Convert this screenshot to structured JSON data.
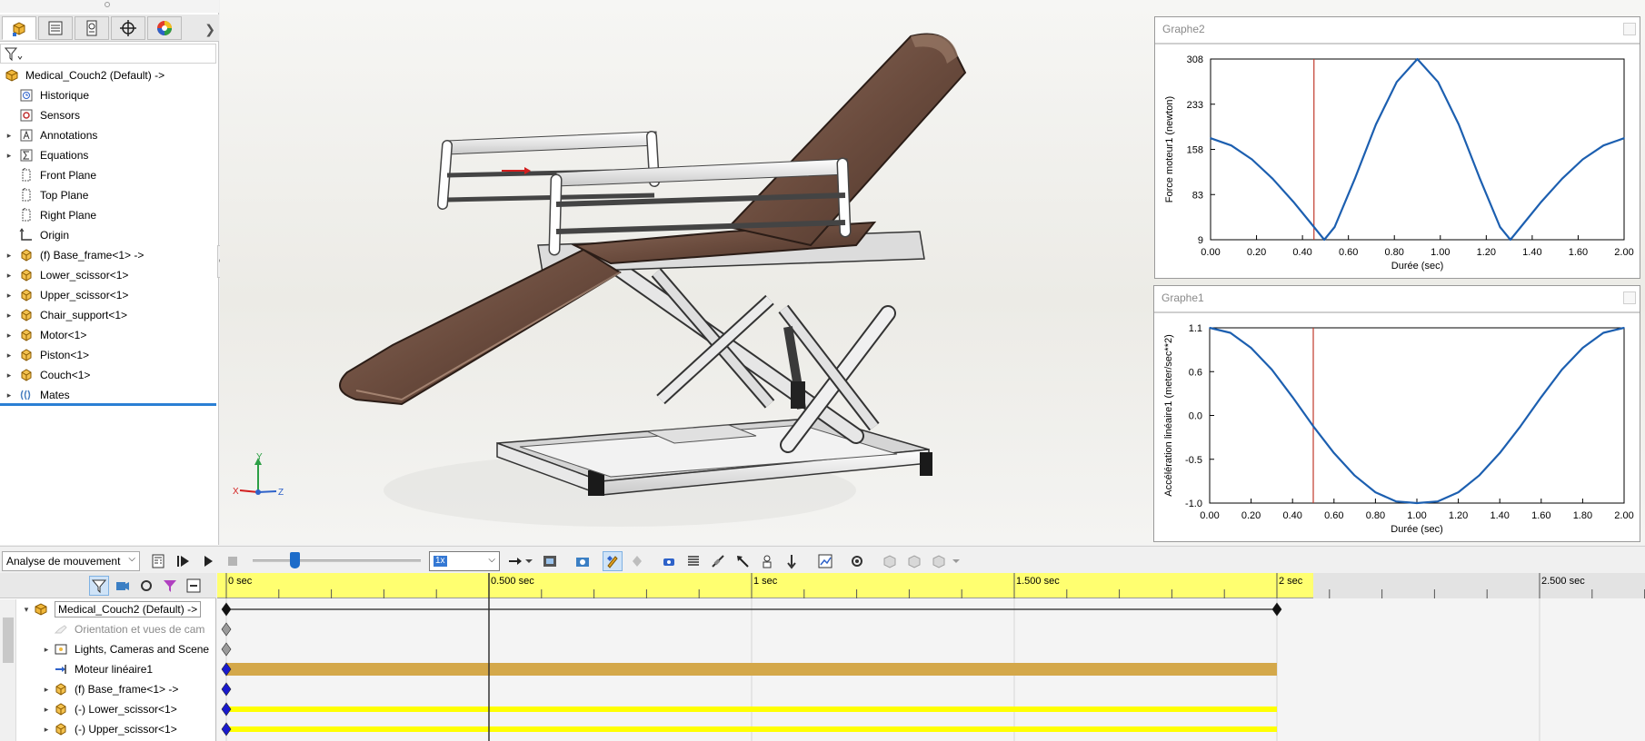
{
  "feature_manager": {
    "tabs": [
      "featuremanager-tab",
      "propertymanager-tab",
      "configuration-tab",
      "dimxpert-tab",
      "appearance-tab"
    ],
    "tree": [
      {
        "label": "Medical_Couch2  (Default) ->",
        "icon": "assembly-icon",
        "expandable": false
      },
      {
        "label": "Historique",
        "icon": "history-icon",
        "expandable": false
      },
      {
        "label": "Sensors",
        "icon": "sensor-icon",
        "expandable": false
      },
      {
        "label": "Annotations",
        "icon": "annotation-icon",
        "expandable": true
      },
      {
        "label": "Equations",
        "icon": "equation-icon",
        "expandable": true
      },
      {
        "label": "Front Plane",
        "icon": "plane-icon",
        "expandable": false
      },
      {
        "label": "Top Plane",
        "icon": "plane-icon",
        "expandable": false
      },
      {
        "label": "Right Plane",
        "icon": "plane-icon",
        "expandable": false
      },
      {
        "label": "Origin",
        "icon": "origin-icon",
        "expandable": false
      },
      {
        "label": "(f) Base_frame<1> ->",
        "icon": "part-icon",
        "expandable": true
      },
      {
        "label": "Lower_scissor<1>",
        "icon": "part-icon",
        "expandable": true
      },
      {
        "label": "Upper_scissor<1>",
        "icon": "part-icon",
        "expandable": true
      },
      {
        "label": "Chair_support<1>",
        "icon": "part-icon",
        "expandable": true
      },
      {
        "label": "Motor<1>",
        "icon": "part-icon",
        "expandable": true
      },
      {
        "label": "Piston<1>",
        "icon": "part-icon",
        "expandable": true
      },
      {
        "label": "Couch<1>",
        "icon": "part-icon",
        "expandable": true
      },
      {
        "label": "Mates",
        "icon": "mates-icon",
        "expandable": true
      }
    ]
  },
  "graphs": [
    {
      "title": "Graphe2",
      "ylabel": "Force moteur1 (newton)",
      "xlabel": "Durée (sec)",
      "yticks": [
        "308",
        "233",
        "158",
        "83",
        "9"
      ],
      "xticks": [
        "0.00",
        "0.20",
        "0.40",
        "0.60",
        "0.80",
        "1.00",
        "1.20",
        "1.40",
        "1.60",
        "2.00"
      ]
    },
    {
      "title": "Graphe1",
      "ylabel": "Accélération linéaire1 (meter/sec**2)",
      "xlabel": "Durée (sec)",
      "yticks": [
        "1.1",
        "0.6",
        "0.0",
        "-0.5",
        "-1.0"
      ],
      "xticks": [
        "0.00",
        "0.20",
        "0.40",
        "0.60",
        "0.80",
        "1.00",
        "1.20",
        "1.40",
        "1.60",
        "1.80",
        "2.00"
      ]
    }
  ],
  "chart_data": [
    {
      "type": "line",
      "title": "Graphe2",
      "xlabel": "Durée (sec)",
      "ylabel": "Force moteur1 (newton)",
      "xlim": [
        0,
        2
      ],
      "ylim": [
        9,
        308
      ],
      "x": [
        0,
        0.1,
        0.2,
        0.3,
        0.4,
        0.5,
        0.55,
        0.6,
        0.7,
        0.8,
        0.9,
        1.0,
        1.1,
        1.2,
        1.3,
        1.4,
        1.45,
        1.5,
        1.6,
        1.7,
        1.8,
        1.9,
        2.0
      ],
      "series": [
        {
          "values": [
            177,
            165,
            142,
            110,
            72,
            30,
            9,
            30,
            112,
            200,
            270,
            308,
            270,
            200,
            112,
            30,
            9,
            30,
            72,
            110,
            142,
            165,
            177
          ]
        }
      ],
      "cursor_x": 0.5
    },
    {
      "type": "line",
      "title": "Graphe1",
      "xlabel": "Durée (sec)",
      "ylabel": "Accélération linéaire1 (meter/sec**2)",
      "xlim": [
        0,
        2
      ],
      "ylim": [
        -1.0,
        1.1
      ],
      "x": [
        0,
        0.1,
        0.2,
        0.3,
        0.4,
        0.5,
        0.6,
        0.7,
        0.8,
        0.9,
        1.0,
        1.1,
        1.2,
        1.3,
        1.4,
        1.5,
        1.6,
        1.7,
        1.8,
        1.9,
        2.0
      ],
      "series": [
        {
          "values": [
            1.1,
            1.04,
            0.86,
            0.6,
            0.27,
            -0.08,
            -0.4,
            -0.67,
            -0.87,
            -0.98,
            -1.0,
            -0.98,
            -0.87,
            -0.67,
            -0.4,
            -0.08,
            0.27,
            0.6,
            0.86,
            1.04,
            1.1
          ]
        }
      ],
      "cursor_x": 0.5
    }
  ],
  "motion_toolbar": {
    "study_type": "Analyse de mouvement",
    "speed": "1x",
    "slider_fraction": 0.25
  },
  "motion_tree": [
    {
      "label": "Medical_Couch2  (Default) ->",
      "icon": "assembly-icon",
      "arrow": "down",
      "muted": false
    },
    {
      "label": "Orientation et vues de cam",
      "icon": "camera-icon",
      "arrow": "",
      "muted": true
    },
    {
      "label": "Lights, Cameras and Scene",
      "icon": "lights-icon",
      "arrow": "right",
      "muted": false
    },
    {
      "label": "Moteur linéaire1",
      "icon": "linear-motor-icon",
      "arrow": "",
      "muted": false
    },
    {
      "label": "(f) Base_frame<1> ->",
      "icon": "part-icon",
      "arrow": "right",
      "muted": false
    },
    {
      "label": "(-) Lower_scissor<1>",
      "icon": "part-icon",
      "arrow": "right",
      "muted": false
    },
    {
      "label": "(-) Upper_scissor<1>",
      "icon": "part-icon",
      "arrow": "right",
      "muted": false
    }
  ],
  "timeline": {
    "labels": [
      "0 sec",
      "0.500 sec",
      "1 sec",
      "1.500 sec",
      "2 sec",
      "2.500 sec"
    ],
    "duration_sec": 2,
    "current_time_sec": 0.5,
    "colors": {
      "ruler": "#ffff70",
      "motor_bar": "#d4a84a",
      "component_bar": "#ffff00",
      "key_diamond": "#1a1acc"
    }
  },
  "triad": {
    "x": "X",
    "y": "Y",
    "z": "Z"
  },
  "colors": {
    "accent": "#2a7fd4",
    "curve": "#1c5fb0",
    "cursor": "#c0392b"
  }
}
